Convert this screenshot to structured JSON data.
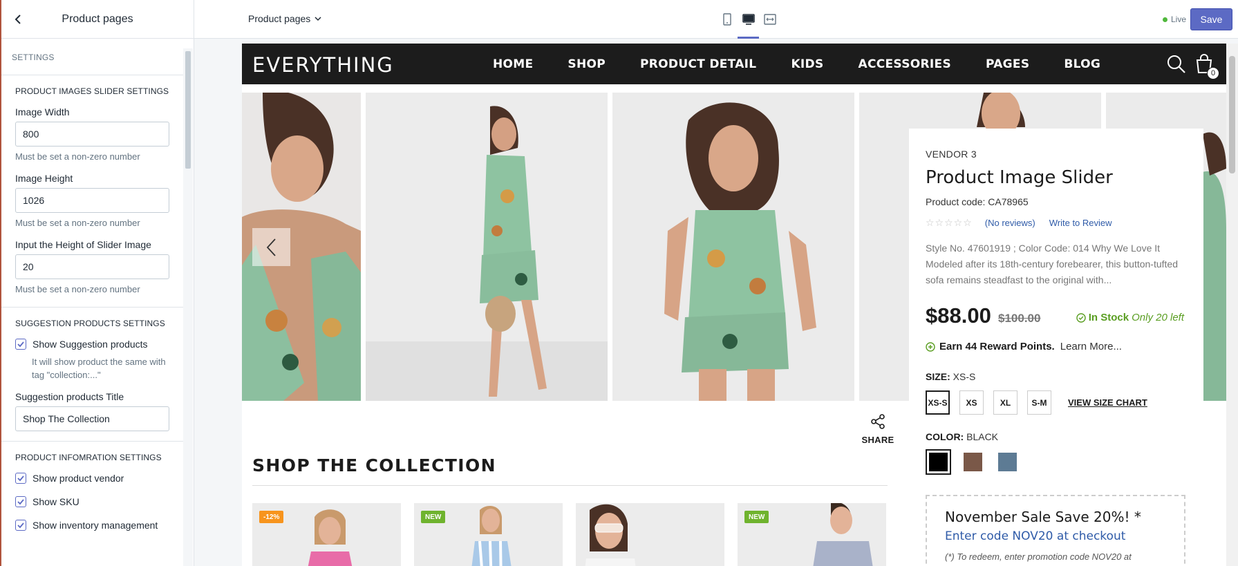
{
  "sidebar": {
    "title": "Product pages",
    "section_label": "SETTINGS",
    "slider_group": {
      "title": "PRODUCT IMAGES SLIDER SETTINGS",
      "fields": [
        {
          "label": "Image Width",
          "value": "800",
          "help": "Must be set a non-zero number"
        },
        {
          "label": "Image Height",
          "value": "1026",
          "help": "Must be set a non-zero number"
        },
        {
          "label": "Input the Height of Slider Image",
          "value": "20",
          "help": "Must be set a non-zero number"
        }
      ]
    },
    "suggestion_group": {
      "title": "SUGGESTION PRODUCTS SETTINGS",
      "show_label": "Show Suggestion products",
      "show_checked": true,
      "note": "It will show product the same with tag \"collection:...\"",
      "title_label": "Suggestion products Title",
      "title_value": "Shop The Collection"
    },
    "info_group": {
      "title": "PRODUCT INFOMRATION SETTINGS",
      "checks": [
        {
          "label": "Show product vendor",
          "checked": true
        },
        {
          "label": "Show SKU",
          "checked": true
        },
        {
          "label": "Show inventory management",
          "checked": true
        }
      ]
    }
  },
  "topbar": {
    "page_select": "Product pages",
    "devices": [
      "mobile-icon",
      "desktop-icon",
      "fullwidth-icon"
    ],
    "active_device": "desktop",
    "live_label": "Live",
    "save_label": "Save"
  },
  "store": {
    "logo": "EVERYTHING",
    "nav": [
      "HOME",
      "SHOP",
      "PRODUCT DETAIL",
      "KIDS",
      "ACCESSORIES",
      "PAGES",
      "BLOG"
    ],
    "cart_count": "0",
    "share_label": "SHARE",
    "collection_title": "SHOP THE COLLECTION",
    "collection_badges": [
      "-12%",
      "NEW",
      "",
      "NEW"
    ]
  },
  "product": {
    "vendor": "VENDOR 3",
    "title": "Product Image Slider",
    "code": "Product code: CA78965",
    "rating": 0,
    "no_reviews": "(No reviews)",
    "write_review": "Write to Review",
    "description": "Style No. 47601919 ; Color Code: 014 Why We Love It Modeled after its 18th-century forebearer, this button-tufted sofa remains steadfast to the original with...",
    "price": "$88.00",
    "old_price": "$100.00",
    "stock_status": "In Stock",
    "stock_left": "Only 20 left",
    "reward": "Earn 44 Reward Points.",
    "learn_more": "Learn More...",
    "size_label": "SIZE:",
    "size_value": "XS-S",
    "sizes": [
      "XS-S",
      "XS",
      "XL",
      "S-M"
    ],
    "size_chart": "VIEW SIZE CHART",
    "color_label": "COLOR:",
    "color_value": "BLACK",
    "colors": [
      "#000000",
      "#7a5848",
      "#5d7b94"
    ],
    "promo_title": "November Sale Save 20%! *",
    "promo_code": "Enter code NOV20 at checkout",
    "promo_note": "(*) To redeem, enter promotion code NOV20 at"
  },
  "colors": {
    "accent": "#5c6ac4",
    "nav_bg": "#1c1c1c",
    "stock_green": "#5a9e22",
    "link_blue": "#2f5ba8"
  }
}
